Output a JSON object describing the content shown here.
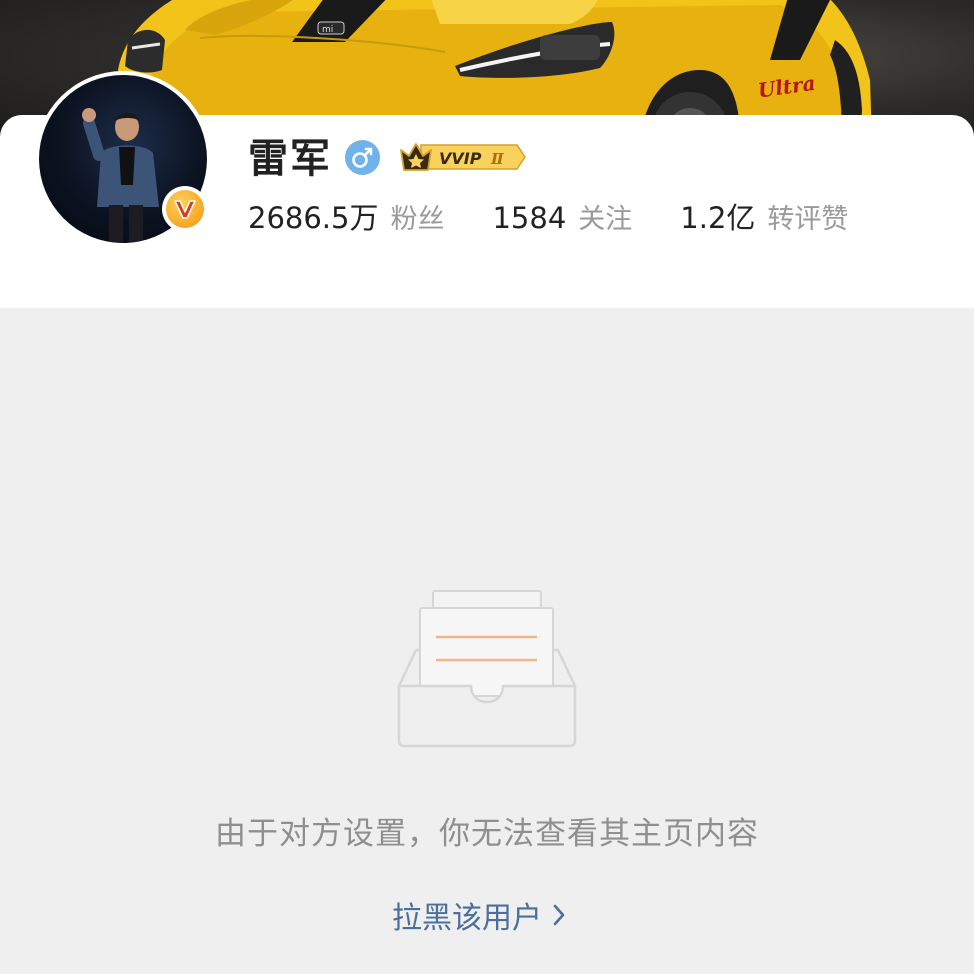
{
  "profile": {
    "name": "雷军",
    "gender_icon": "male-icon",
    "vip_label": "VVIP",
    "vip_level": "Ⅱ",
    "verified_badge_icon": "v-verified-icon",
    "avatar_icon": "person-on-stage-avatar"
  },
  "cover": {
    "car_text": "Ultra",
    "logo_text": "mi"
  },
  "stats": [
    {
      "value": "2686.5万",
      "label": "粉丝"
    },
    {
      "value": "1584",
      "label": "关注"
    },
    {
      "value": "1.2亿",
      "label": "转评赞"
    }
  ],
  "empty_state": {
    "icon": "empty-inbox-icon",
    "message": "由于对方设置，你无法查看其主页内容"
  },
  "actions": {
    "block_user_label": "拉黑该用户",
    "block_user_icon": "chevron-right-icon"
  },
  "colors": {
    "link": "#4a6f9c",
    "gender": "#6fb3ea",
    "vip_gold": "#f5c542",
    "badge_orange": "#f6a623",
    "page_bg": "#efefef"
  }
}
